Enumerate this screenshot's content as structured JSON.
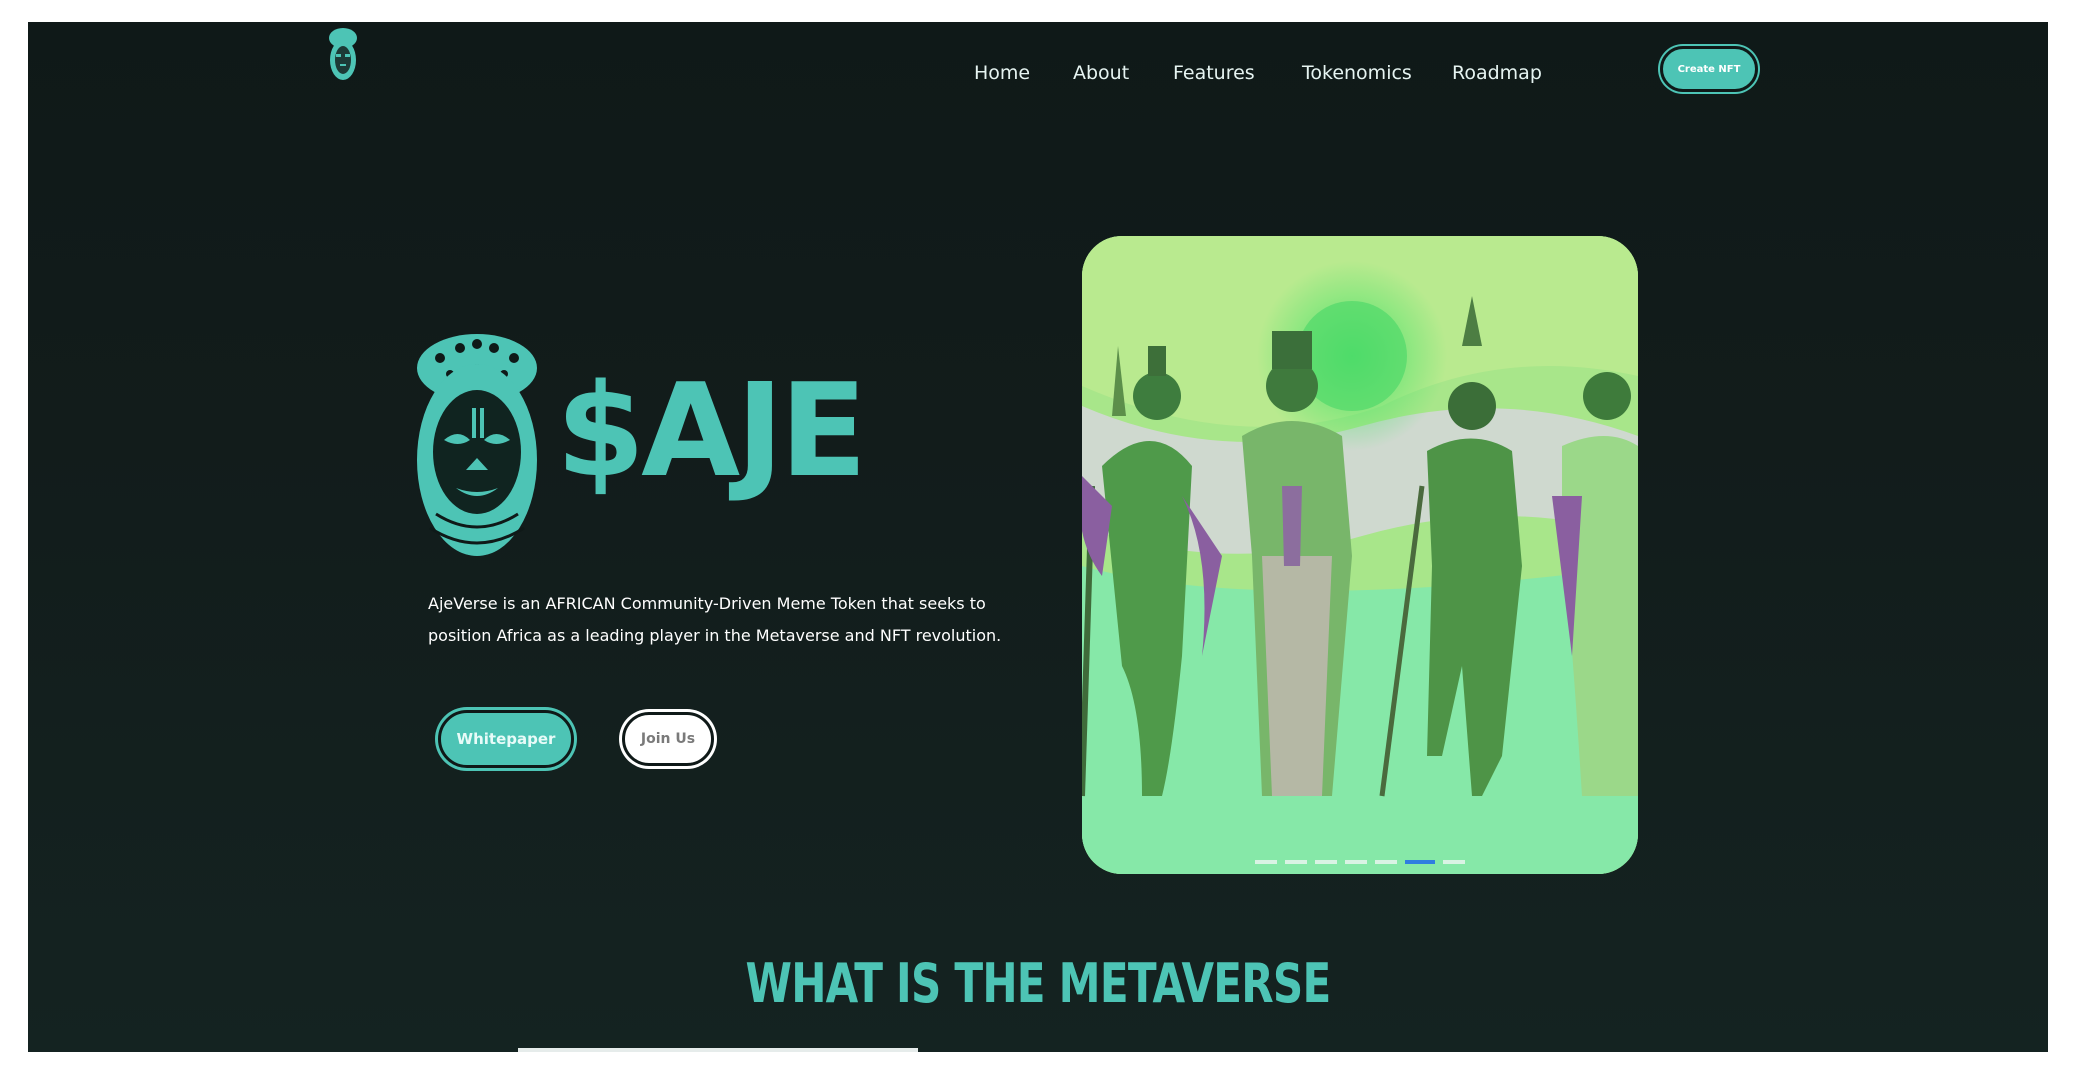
{
  "nav": {
    "items": [
      {
        "label": "Home"
      },
      {
        "label": "About"
      },
      {
        "label": "Features"
      },
      {
        "label": "Tokenomics"
      },
      {
        "label": "Roadmap"
      }
    ],
    "cta_label": "Create NFT"
  },
  "hero": {
    "title": "$AJE",
    "description_line1": "AjeVerse is an AFRICAN Community-Driven Meme Token that seeks to",
    "description_line2": "position Africa as a leading player in the Metaverse and NFT revolution.",
    "whitepaper_label": "Whitepaper",
    "join_label": "Join Us"
  },
  "carousel": {
    "slide_count": 7,
    "active_index": 5
  },
  "section": {
    "title": "WHAT IS THE METAVERSE"
  },
  "colors": {
    "accent": "#4dc4b5",
    "background": "#0f1918",
    "carousel_bg": "#8be3a0",
    "active_dot": "#2f7de0"
  },
  "icons": {
    "logo": "african-mask-icon"
  }
}
